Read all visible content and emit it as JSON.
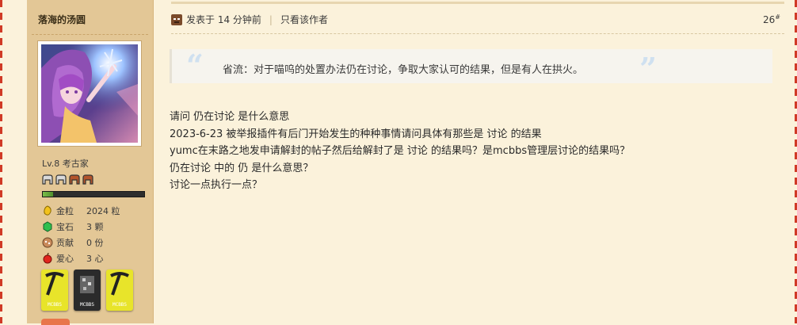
{
  "author": {
    "username": "落海的汤圆",
    "level": "Lv.8 考古家",
    "xp_fraction": 0.1,
    "stats": [
      {
        "icon": "gold-nugget-icon",
        "label": "金粒",
        "value": "2024 粒"
      },
      {
        "icon": "emerald-icon",
        "label": "宝石",
        "value": "3 颗"
      },
      {
        "icon": "contribution-icon",
        "label": "贡献",
        "value": "0 份"
      },
      {
        "icon": "apple-heart-icon",
        "label": "爱心",
        "value": "3 心"
      }
    ],
    "medals": [
      {
        "name": "pickaxe-medal",
        "text": "MCBBS",
        "color": "#e8e42a"
      },
      {
        "name": "ore-medal",
        "text": "MCBBS",
        "color": "#2b2b2b"
      },
      {
        "name": "pickaxe-medal",
        "text": "MCBBS",
        "color": "#e8e42a"
      }
    ]
  },
  "post": {
    "time": "发表于 14 分钟前",
    "only_author": "只看该作者",
    "floor_number": "26",
    "floor_suffix": "#",
    "quote": "省流：对于喵呜的处置办法仍在讨论，争取大家认可的结果，但是有人在拱火。",
    "lines": [
      "请问 仍在讨论 是什么意思",
      "2023-6-23 被举报插件有后门开始发生的种种事情请问具体有那些是 讨论 的结果",
      "yumc在末路之地发申请解封的帖子然后给解封了是 讨论 的结果吗？是mcbbs管理层讨论的结果吗？",
      "仍在讨论 中的 仍 是什么意思？",
      "讨论一点执行一点？"
    ]
  }
}
